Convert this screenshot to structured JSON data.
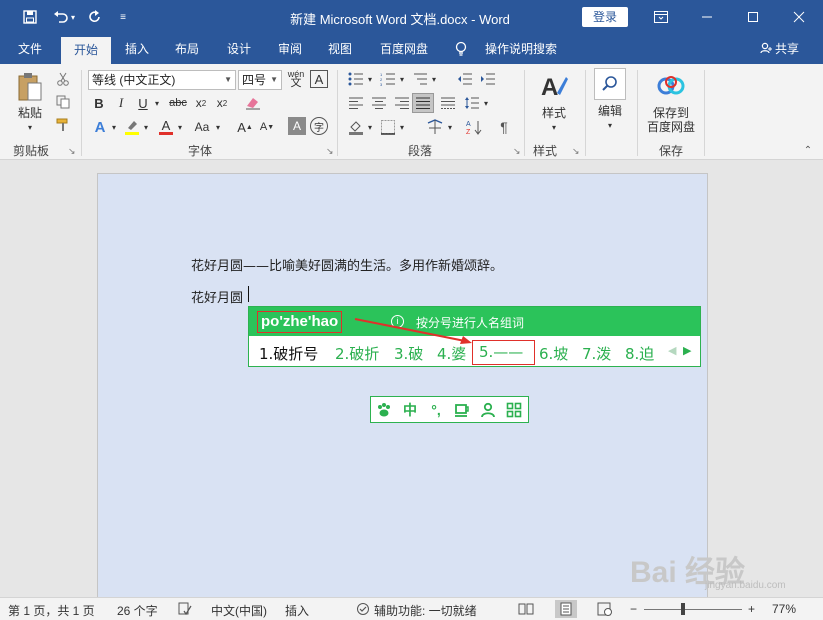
{
  "titlebar": {
    "doc_title": "新建 Microsoft Word 文档.docx  -  Word",
    "login": "登录",
    "icons": [
      "save-icon",
      "undo-icon",
      "redo-icon",
      "customize-icon"
    ],
    "window_buttons": [
      "ribbon-display-icon",
      "minimize-icon",
      "maximize-icon",
      "close-icon"
    ]
  },
  "tabs": {
    "items": [
      "文件",
      "开始",
      "插入",
      "布局",
      "设计",
      "审阅",
      "视图",
      "百度网盘",
      "操作说明搜索"
    ],
    "active": "开始",
    "share": "共享"
  },
  "ribbon": {
    "clipboard": {
      "paste": "粘贴",
      "label": "剪贴板"
    },
    "font": {
      "font_name": "等线 (中文正文)",
      "font_size": "四号",
      "label": "字体"
    },
    "paragraph": {
      "label": "段落"
    },
    "styles": {
      "styles_btn": "样式",
      "label": "样式"
    },
    "editing": {
      "edit_btn": "编辑"
    },
    "save": {
      "save_btn_line1": "保存到",
      "save_btn_line2": "百度网盘",
      "label": "保存"
    }
  },
  "document": {
    "line1": "花好月圆——比喻美好圆满的生活。多用作新婚颂辞。",
    "line2": "花好月圆"
  },
  "ime": {
    "pinyin": "po'zhe'hao",
    "hint": "按分号进行人名组词",
    "candidates": [
      "1.破折号",
      "2.破折",
      "3.破",
      "4.婆",
      "5.——",
      "6.坡",
      "7.泼",
      "8.迫"
    ],
    "status_icons": [
      "paw-icon",
      "中",
      "punctuation-icon",
      "cup-icon",
      "user-icon",
      "grid-icon"
    ]
  },
  "statusbar": {
    "page": "第 1 页，共 1 页",
    "words": "26 个字",
    "language": "中文(中国)",
    "mode": "插入",
    "accessibility": "辅助功能: 一切就绪",
    "zoom": "77%",
    "zoom_minus": "−",
    "zoom_plus": "+"
  },
  "watermark": {
    "text": "Bai 经验",
    "sub": "jingyan.baidu.com"
  },
  "colors": {
    "word_blue": "#2b579a",
    "ime_green": "#2bc35a",
    "highlight_red": "#e0302a",
    "page_bg": "#d9e2f3"
  }
}
